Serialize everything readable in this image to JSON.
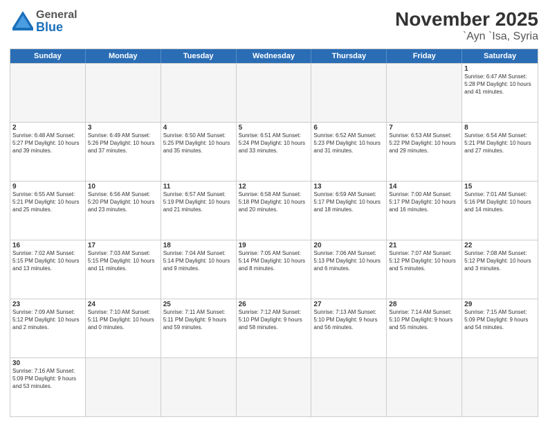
{
  "header": {
    "logo_general": "General",
    "logo_blue": "Blue",
    "month": "November 2025",
    "location": "`Ayn `Isa, Syria"
  },
  "days": [
    "Sunday",
    "Monday",
    "Tuesday",
    "Wednesday",
    "Thursday",
    "Friday",
    "Saturday"
  ],
  "weeks": [
    [
      {
        "day": "",
        "content": ""
      },
      {
        "day": "",
        "content": ""
      },
      {
        "day": "",
        "content": ""
      },
      {
        "day": "",
        "content": ""
      },
      {
        "day": "",
        "content": ""
      },
      {
        "day": "",
        "content": ""
      },
      {
        "day": "1",
        "content": "Sunrise: 6:47 AM\nSunset: 5:28 PM\nDaylight: 10 hours and 41 minutes."
      }
    ],
    [
      {
        "day": "2",
        "content": "Sunrise: 6:48 AM\nSunset: 5:27 PM\nDaylight: 10 hours and 39 minutes."
      },
      {
        "day": "3",
        "content": "Sunrise: 6:49 AM\nSunset: 5:26 PM\nDaylight: 10 hours and 37 minutes."
      },
      {
        "day": "4",
        "content": "Sunrise: 6:50 AM\nSunset: 5:25 PM\nDaylight: 10 hours and 35 minutes."
      },
      {
        "day": "5",
        "content": "Sunrise: 6:51 AM\nSunset: 5:24 PM\nDaylight: 10 hours and 33 minutes."
      },
      {
        "day": "6",
        "content": "Sunrise: 6:52 AM\nSunset: 5:23 PM\nDaylight: 10 hours and 31 minutes."
      },
      {
        "day": "7",
        "content": "Sunrise: 6:53 AM\nSunset: 5:22 PM\nDaylight: 10 hours and 29 minutes."
      },
      {
        "day": "8",
        "content": "Sunrise: 6:54 AM\nSunset: 5:21 PM\nDaylight: 10 hours and 27 minutes."
      }
    ],
    [
      {
        "day": "9",
        "content": "Sunrise: 6:55 AM\nSunset: 5:21 PM\nDaylight: 10 hours and 25 minutes."
      },
      {
        "day": "10",
        "content": "Sunrise: 6:56 AM\nSunset: 5:20 PM\nDaylight: 10 hours and 23 minutes."
      },
      {
        "day": "11",
        "content": "Sunrise: 6:57 AM\nSunset: 5:19 PM\nDaylight: 10 hours and 21 minutes."
      },
      {
        "day": "12",
        "content": "Sunrise: 6:58 AM\nSunset: 5:18 PM\nDaylight: 10 hours and 20 minutes."
      },
      {
        "day": "13",
        "content": "Sunrise: 6:59 AM\nSunset: 5:17 PM\nDaylight: 10 hours and 18 minutes."
      },
      {
        "day": "14",
        "content": "Sunrise: 7:00 AM\nSunset: 5:17 PM\nDaylight: 10 hours and 16 minutes."
      },
      {
        "day": "15",
        "content": "Sunrise: 7:01 AM\nSunset: 5:16 PM\nDaylight: 10 hours and 14 minutes."
      }
    ],
    [
      {
        "day": "16",
        "content": "Sunrise: 7:02 AM\nSunset: 5:15 PM\nDaylight: 10 hours and 13 minutes."
      },
      {
        "day": "17",
        "content": "Sunrise: 7:03 AM\nSunset: 5:15 PM\nDaylight: 10 hours and 11 minutes."
      },
      {
        "day": "18",
        "content": "Sunrise: 7:04 AM\nSunset: 5:14 PM\nDaylight: 10 hours and 9 minutes."
      },
      {
        "day": "19",
        "content": "Sunrise: 7:05 AM\nSunset: 5:14 PM\nDaylight: 10 hours and 8 minutes."
      },
      {
        "day": "20",
        "content": "Sunrise: 7:06 AM\nSunset: 5:13 PM\nDaylight: 10 hours and 6 minutes."
      },
      {
        "day": "21",
        "content": "Sunrise: 7:07 AM\nSunset: 5:12 PM\nDaylight: 10 hours and 5 minutes."
      },
      {
        "day": "22",
        "content": "Sunrise: 7:08 AM\nSunset: 5:12 PM\nDaylight: 10 hours and 3 minutes."
      }
    ],
    [
      {
        "day": "23",
        "content": "Sunrise: 7:09 AM\nSunset: 5:12 PM\nDaylight: 10 hours and 2 minutes."
      },
      {
        "day": "24",
        "content": "Sunrise: 7:10 AM\nSunset: 5:11 PM\nDaylight: 10 hours and 0 minutes."
      },
      {
        "day": "25",
        "content": "Sunrise: 7:11 AM\nSunset: 5:11 PM\nDaylight: 9 hours and 59 minutes."
      },
      {
        "day": "26",
        "content": "Sunrise: 7:12 AM\nSunset: 5:10 PM\nDaylight: 9 hours and 58 minutes."
      },
      {
        "day": "27",
        "content": "Sunrise: 7:13 AM\nSunset: 5:10 PM\nDaylight: 9 hours and 56 minutes."
      },
      {
        "day": "28",
        "content": "Sunrise: 7:14 AM\nSunset: 5:10 PM\nDaylight: 9 hours and 55 minutes."
      },
      {
        "day": "29",
        "content": "Sunrise: 7:15 AM\nSunset: 5:09 PM\nDaylight: 9 hours and 54 minutes."
      }
    ],
    [
      {
        "day": "30",
        "content": "Sunrise: 7:16 AM\nSunset: 5:09 PM\nDaylight: 9 hours and 53 minutes."
      },
      {
        "day": "",
        "content": ""
      },
      {
        "day": "",
        "content": ""
      },
      {
        "day": "",
        "content": ""
      },
      {
        "day": "",
        "content": ""
      },
      {
        "day": "",
        "content": ""
      },
      {
        "day": "",
        "content": ""
      }
    ]
  ]
}
